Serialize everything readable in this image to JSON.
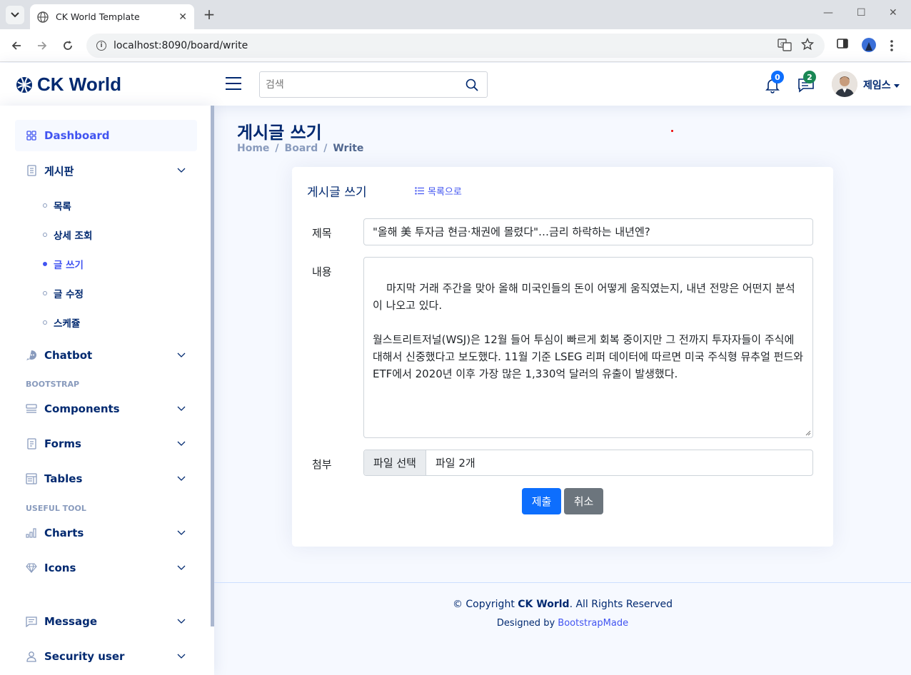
{
  "browser": {
    "tab_title": "CK World Template",
    "url": "localhost:8090/board/write"
  },
  "header": {
    "logo_text": "CK World",
    "search_placeholder": "검색",
    "notifications_count": "0",
    "messages_count": "2",
    "profile_name": "제임스"
  },
  "sidebar": {
    "dashboard": "Dashboard",
    "board": "게시판",
    "board_sub": [
      "목록",
      "상세 조회",
      "글 쓰기",
      "글 수정",
      "스케쥴"
    ],
    "chatbot": "Chatbot",
    "heading_bootstrap": "BOOTSTRAP",
    "components": "Components",
    "forms": "Forms",
    "tables": "Tables",
    "heading_useful": "USEFUL TOOL",
    "charts": "Charts",
    "icons": "Icons",
    "message": "Message",
    "security_user": "Security user"
  },
  "page": {
    "title": "게시글 쓰기",
    "breadcrumb": [
      "Home",
      "Board",
      "Write"
    ]
  },
  "card": {
    "title": "게시글 쓰기",
    "list_link": "목록으로",
    "subject_label": "제목",
    "subject_value": "\"올해 美 투자금 현금·채권에 몰렸다\"…금리 하락하는 내년엔?",
    "content_label": "내용",
    "content_value": "마지막 거래 주간을 맞아 올해 미국인들의 돈이 어떻게 움직였는지, 내년 전망은 어떤지 분석이 나오고 있다.\n\n월스트리트저널(WSJ)은 12월 들어 투심이 빠르게 회복 중이지만 그 전까지 투자자들이 주식에 대해서 신중했다고 보도했다. 11월 기준 LSEG 리퍼 데이터에 따르면 미국 주식형 뮤추얼 펀드와 ETF에서 2020년 이후 가장 많은 1,330억 달러의 유출이 발생했다.",
    "attach_label": "첨부",
    "file_button": "파일 선택",
    "file_name": "파일 2개",
    "submit": "제출",
    "cancel": "취소"
  },
  "footer": {
    "copyright_prefix": "© Copyright ",
    "brand": "CK World",
    "copyright_suffix": ". All Rights Reserved",
    "designed_prefix": "Designed by ",
    "designed_link": "BootstrapMade"
  },
  "colors": {
    "brand": "#012970",
    "accent": "#4154f1",
    "primary_button": "#0d6efd",
    "secondary_button": "#6c757d",
    "notif_badge": "#0d6efd",
    "msg_badge": "#198754"
  }
}
